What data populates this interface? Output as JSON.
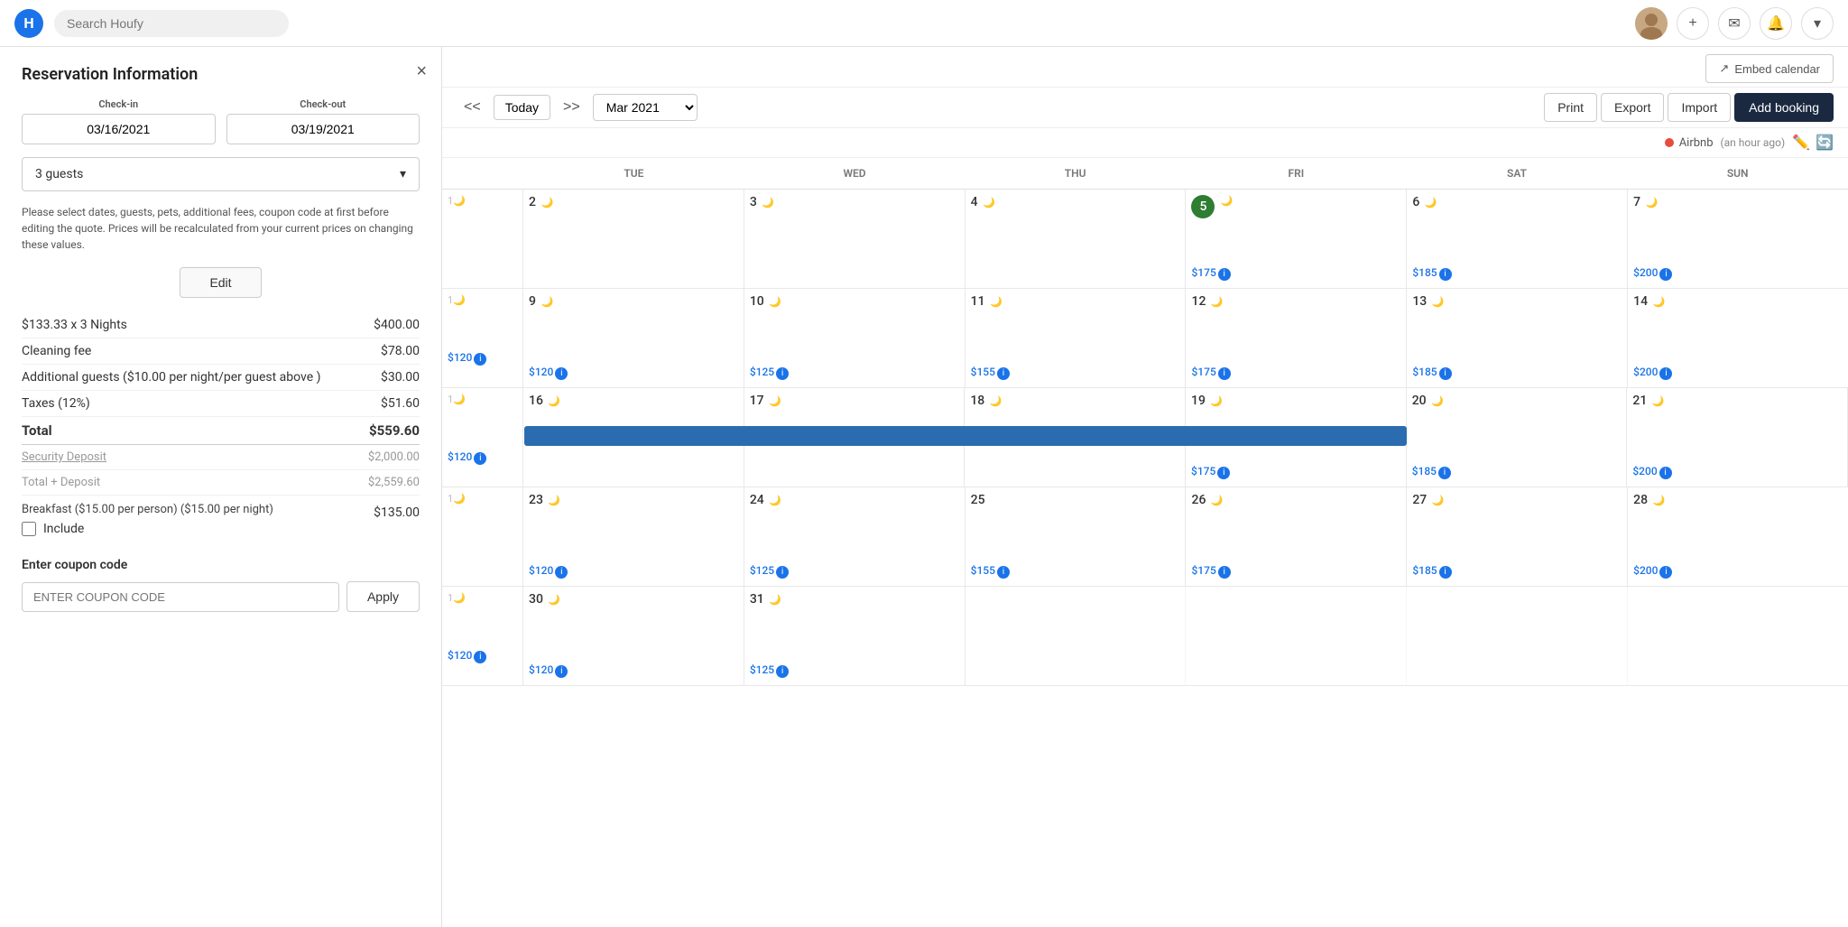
{
  "app": {
    "logo_letter": "H"
  },
  "topnav": {
    "search_placeholder": "Search Houfy",
    "nav_plus": "+",
    "nav_mail": "✉",
    "nav_bell": "🔔",
    "nav_caret": "▾"
  },
  "panel": {
    "title": "Reservation Information",
    "close": "×",
    "checkin_label": "Check-in",
    "checkout_label": "Check-out",
    "checkin_value": "03/16/2021",
    "checkout_value": "03/19/2021",
    "guests_value": "3 guests",
    "guests_caret": "▾",
    "notice": "Please select dates, guests, pets, additional fees, coupon code at first before editing the quote. Prices will be recalculated from your current prices on changing these values.",
    "edit_label": "Edit",
    "fees": [
      {
        "label": "$133.33 x 3 Nights",
        "amount": "$400.00"
      },
      {
        "label": "Cleaning fee",
        "amount": "$78.00"
      },
      {
        "label": "Additional guests ($10.00 per night/per guest above )",
        "amount": "$30.00"
      },
      {
        "label": "Taxes (12%)",
        "amount": "$51.60"
      }
    ],
    "total_label": "Total",
    "total_amount": "$559.60",
    "security_deposit_label": "Security Deposit",
    "security_deposit_amount": "$2,000.00",
    "total_deposit_label": "Total + Deposit",
    "total_deposit_amount": "$2,559.60",
    "breakfast_label": "Breakfast ($15.00 per person) ($15.00 per night)",
    "breakfast_amount": "$135.00",
    "include_label": "Include",
    "coupon_title": "Enter coupon code",
    "coupon_placeholder": "ENTER COUPON CODE",
    "apply_label": "Apply"
  },
  "calendar": {
    "embed_label": "Embed calendar",
    "embed_icon": "↗",
    "prev": "<<",
    "today": "Today",
    "next": ">>",
    "month": "Mar 2021",
    "print_label": "Print",
    "export_label": "Export",
    "import_label": "Import",
    "add_booking_label": "Add booking",
    "airbnb_label": "Airbnb",
    "sync_time": "(an hour ago)",
    "days": [
      "TUE",
      "WED",
      "THU",
      "FRI",
      "SAT",
      "SUN"
    ],
    "weeks": [
      {
        "days": [
          {
            "num": "2",
            "moon": true,
            "price": null,
            "today": false
          },
          {
            "num": "3",
            "moon": true,
            "price": null,
            "today": false
          },
          {
            "num": "4",
            "moon": true,
            "price": null,
            "today": false
          },
          {
            "num": "5",
            "moon": true,
            "price": null,
            "today": true
          },
          {
            "num": "6",
            "moon": true,
            "price": "$185",
            "today": false
          },
          {
            "num": "7",
            "moon": true,
            "price": "$200",
            "today": false
          }
        ],
        "prices": [
          null,
          null,
          null,
          "$175",
          "$185",
          "$200"
        ]
      },
      {
        "days": [
          {
            "num": "9",
            "moon": true,
            "price": "$120",
            "today": false
          },
          {
            "num": "10",
            "moon": true,
            "price": "$125",
            "today": false
          },
          {
            "num": "11",
            "moon": true,
            "price": "$155",
            "today": false
          },
          {
            "num": "12",
            "moon": true,
            "price": "$175",
            "today": false
          },
          {
            "num": "13",
            "moon": true,
            "price": "$185",
            "today": false
          },
          {
            "num": "14",
            "moon": true,
            "price": "$200",
            "today": false
          }
        ]
      },
      {
        "days": [
          {
            "num": "16",
            "moon": true,
            "price": null,
            "today": false,
            "booking": true
          },
          {
            "num": "17",
            "moon": true,
            "price": null,
            "today": false,
            "booking": true
          },
          {
            "num": "18",
            "moon": true,
            "price": null,
            "today": false,
            "booking": true
          },
          {
            "num": "19",
            "moon": true,
            "price": "$175",
            "today": false
          },
          {
            "num": "20",
            "moon": true,
            "price": "$185",
            "today": false
          },
          {
            "num": "21",
            "moon": true,
            "price": "$200",
            "today": false
          }
        ]
      },
      {
        "days": [
          {
            "num": "23",
            "moon": true,
            "price": "$120",
            "today": false
          },
          {
            "num": "24",
            "moon": true,
            "price": "$125",
            "today": false
          },
          {
            "num": "25",
            "moon": false,
            "price": "$155",
            "today": false
          },
          {
            "num": "26",
            "moon": true,
            "price": "$175",
            "today": false
          },
          {
            "num": "27",
            "moon": true,
            "price": "$185",
            "today": false
          },
          {
            "num": "28",
            "moon": true,
            "price": "$200",
            "today": false
          }
        ]
      },
      {
        "days": [
          {
            "num": "30",
            "moon": true,
            "price": "$120",
            "today": false
          },
          {
            "num": "31",
            "moon": true,
            "price": "$125",
            "today": false
          },
          {
            "num": "",
            "moon": false,
            "price": null,
            "today": false
          },
          {
            "num": "",
            "moon": false,
            "price": null,
            "today": false
          },
          {
            "num": "",
            "moon": false,
            "price": null,
            "today": false
          },
          {
            "num": "",
            "moon": false,
            "price": null,
            "today": false
          }
        ]
      }
    ]
  }
}
